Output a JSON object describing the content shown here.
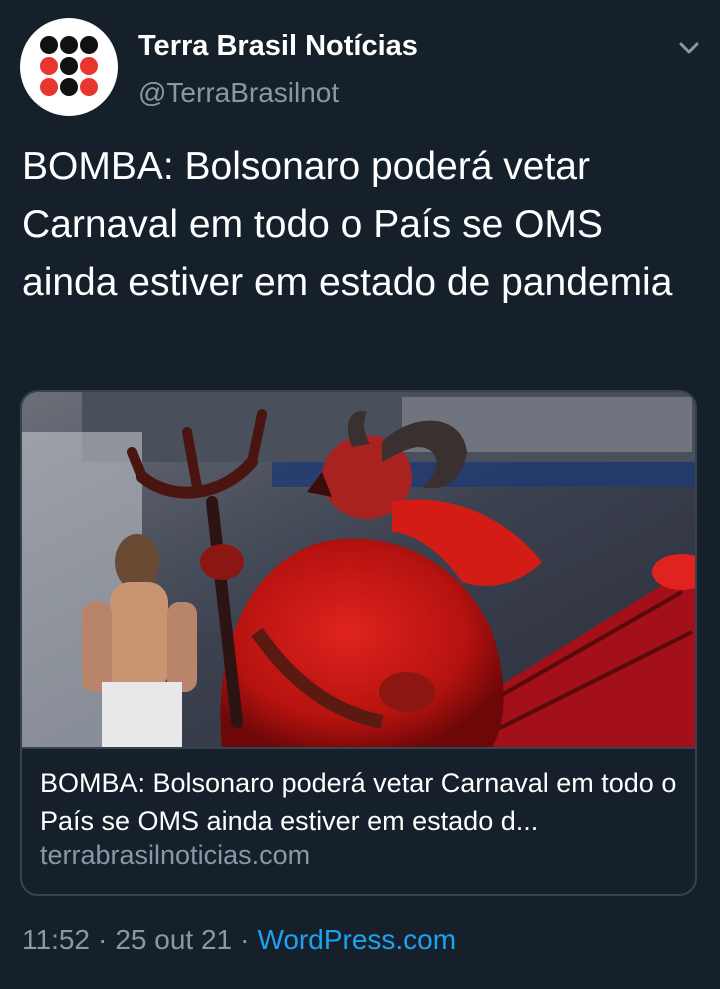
{
  "account": {
    "name": "Terra Brasil Notícias",
    "handle": "@TerraBrasilnot",
    "avatar_icon": "terra-brasil-dot-grid-logo"
  },
  "menu": {
    "icon": "chevron-down-icon"
  },
  "tweet": {
    "text": "BOMBA: Bolsonaro poderá vetar Carnaval em todo o País se OMS ainda estiver em estado de pandemia"
  },
  "card": {
    "image_icon": "carnival-photo",
    "title": "BOMBA: Bolsonaro poderá vetar Carnaval em todo o País se OMS ainda estiver em estado d...",
    "domain": "terrabrasilnoticias.com"
  },
  "meta": {
    "time": "11:52",
    "date": "25 out 21",
    "separator": "·",
    "source": "WordPress.com"
  },
  "colors": {
    "background": "#15202b",
    "secondary_text": "#8899a6",
    "link": "#1da1f2",
    "border": "#38444d",
    "logo_red": "#e8352e",
    "logo_black": "#111111"
  }
}
